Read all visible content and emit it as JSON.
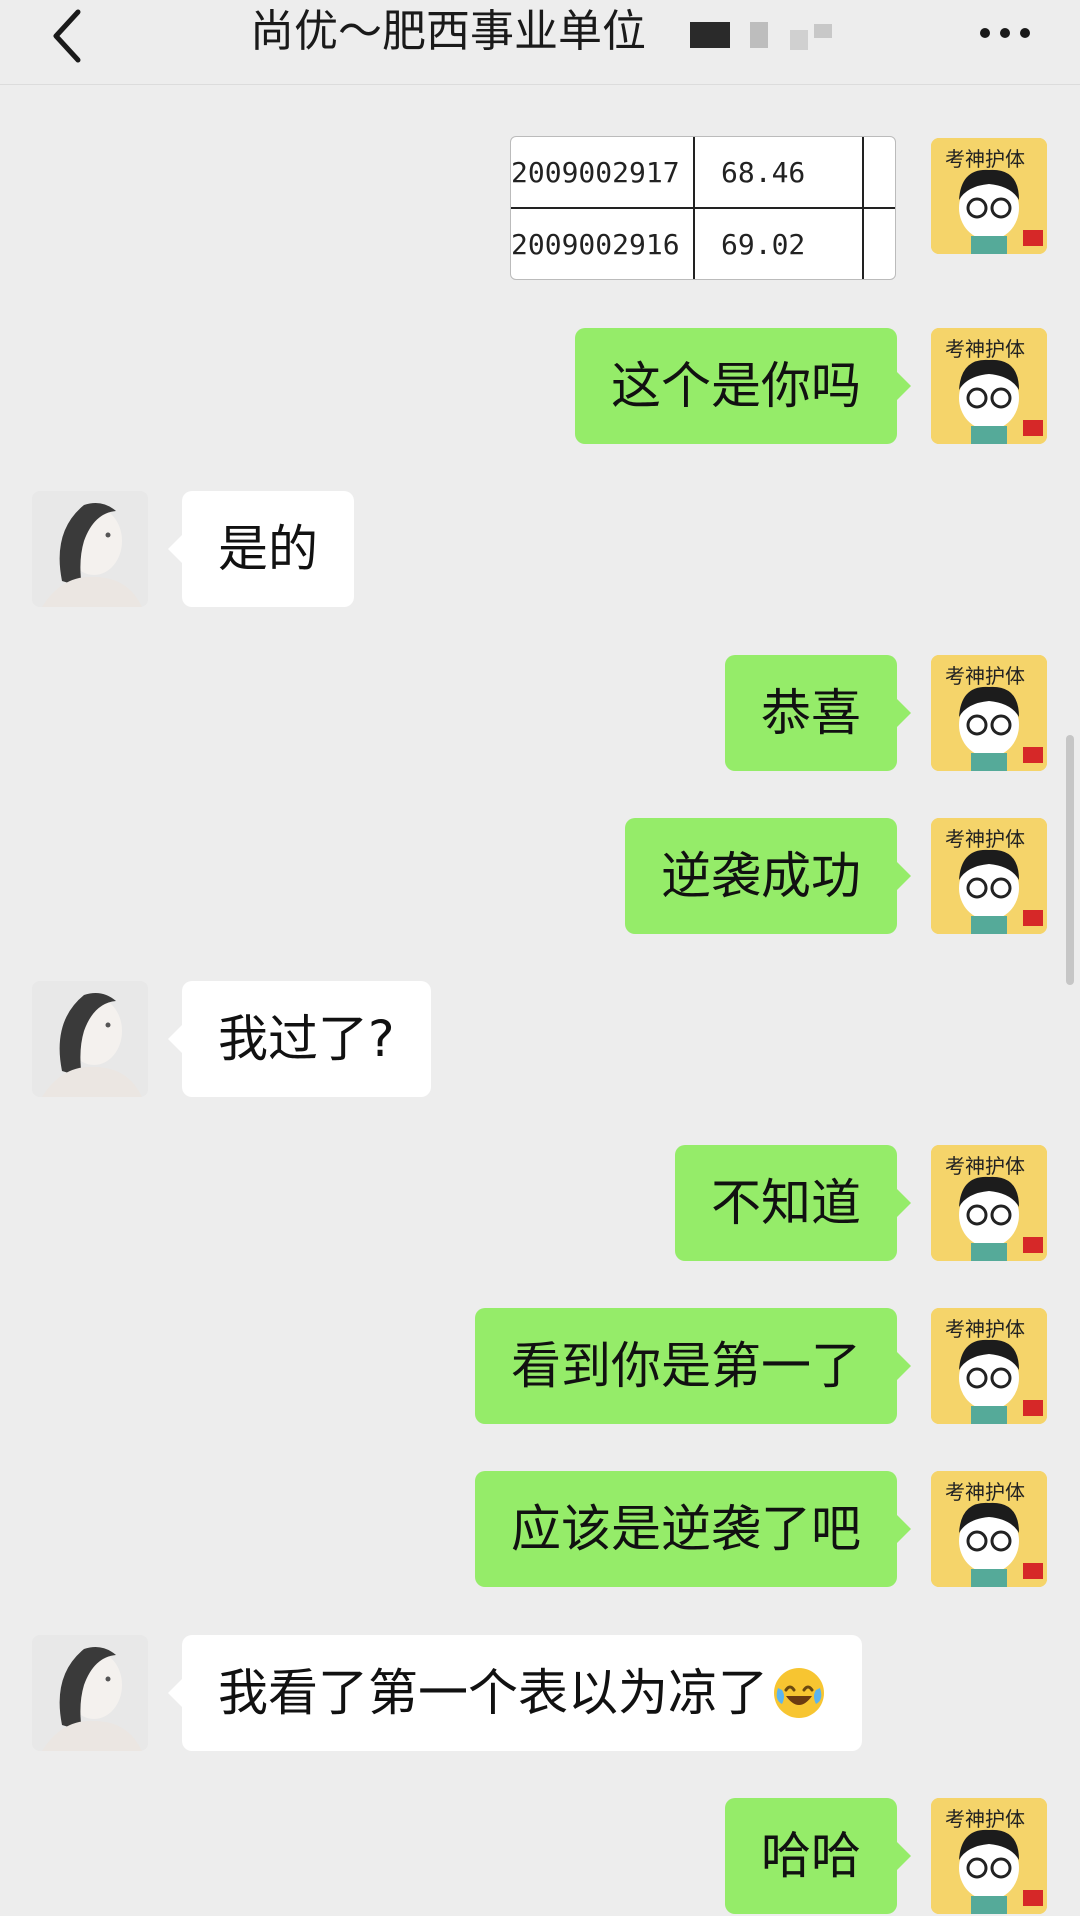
{
  "header": {
    "title": "尚优～肥西事业单位"
  },
  "image_message": {
    "rows": [
      {
        "id": "2009002917",
        "score": "68.46"
      },
      {
        "id": "2009002916",
        "score": "69.02"
      }
    ]
  },
  "messages": [
    {
      "from": "me",
      "text": "这个是你吗"
    },
    {
      "from": "peer",
      "text": "是的"
    },
    {
      "from": "me",
      "text": "恭喜"
    },
    {
      "from": "me",
      "text": "逆袭成功"
    },
    {
      "from": "peer",
      "text": "我过了?"
    },
    {
      "from": "me",
      "text": "不知道"
    },
    {
      "from": "me",
      "text": "看到你是第一了"
    },
    {
      "from": "me",
      "text": "应该是逆袭了吧"
    },
    {
      "from": "peer",
      "text": "我看了第一个表以为凉了",
      "emoji": "laughing-crying-emoji"
    },
    {
      "from": "me",
      "text": "哈哈"
    }
  ],
  "icons": {
    "back": "chevron-left-icon",
    "more": "more-icon",
    "my_avatar": "cartoon-avatar-icon",
    "peer_avatar": "peer-avatar-icon"
  },
  "colors": {
    "background": "#ededed",
    "my_bubble": "#95ec69",
    "peer_bubble": "#ffffff"
  }
}
